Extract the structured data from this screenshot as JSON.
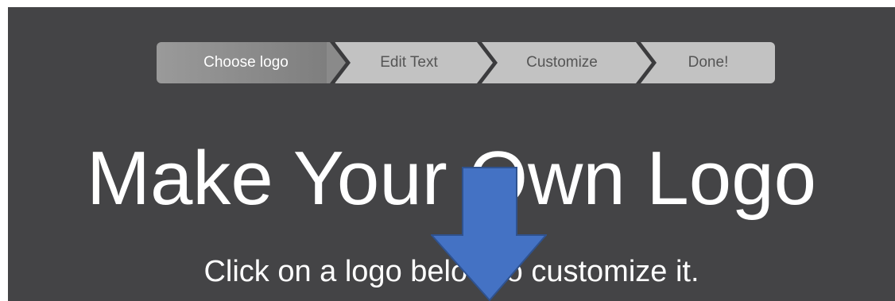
{
  "wizard": {
    "steps": [
      {
        "label": "Choose logo",
        "state": "active"
      },
      {
        "label": "Edit Text",
        "state": "inactive"
      },
      {
        "label": "Customize",
        "state": "inactive"
      },
      {
        "label": "Done!",
        "state": "inactive"
      }
    ]
  },
  "hero": {
    "title": "Make Your Own Logo",
    "subtitle": "Click on a logo below to customize it."
  },
  "overlay": {
    "icon": "down-arrow-icon",
    "color": "#4472c4"
  },
  "colors": {
    "background": "#444446",
    "step_active": "#888888",
    "step_inactive": "#c2c2c2",
    "text": "#ffffff"
  }
}
